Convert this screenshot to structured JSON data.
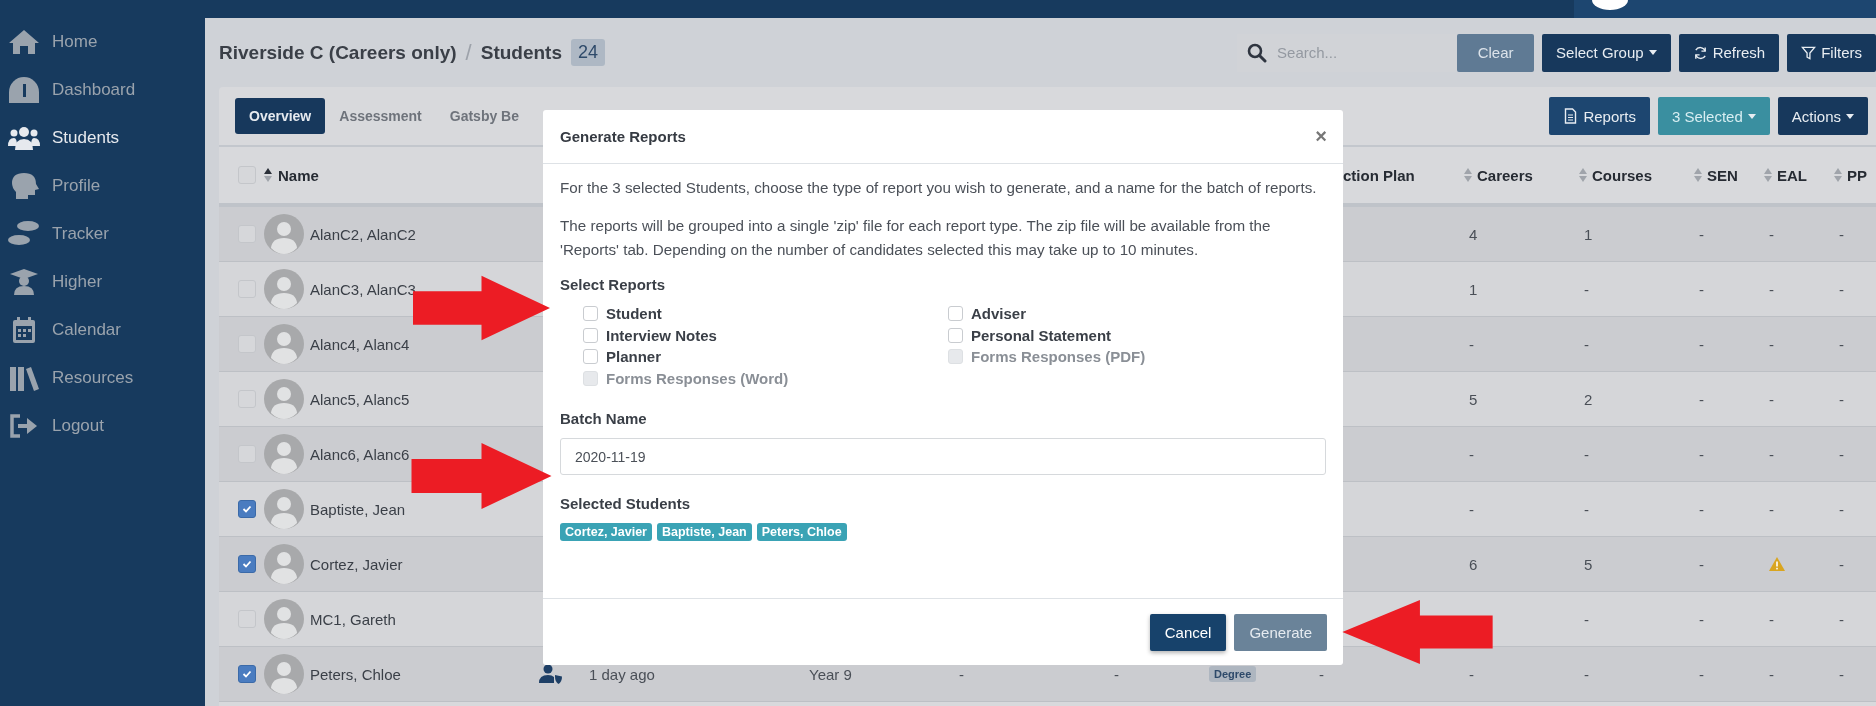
{
  "sidebar": {
    "items": [
      {
        "label": "Home",
        "selected": false
      },
      {
        "label": "Dashboard",
        "selected": false
      },
      {
        "label": "Students",
        "selected": true
      },
      {
        "label": "Profile",
        "selected": false
      },
      {
        "label": "Tracker",
        "selected": false
      },
      {
        "label": "Higher",
        "selected": false
      },
      {
        "label": "Calendar",
        "selected": false
      },
      {
        "label": "Resources",
        "selected": false
      },
      {
        "label": "Logout",
        "selected": false
      }
    ]
  },
  "header": {
    "breadcrumb": "Riverside C (Careers only)",
    "separator": "/",
    "page": "Students",
    "count": "24",
    "search": {
      "placeholder": "Search..."
    },
    "buttons": [
      {
        "label": "Clear",
        "kind": "light"
      },
      {
        "label": "Select Group",
        "kind": "dropdown"
      },
      {
        "label": "Refresh",
        "kind": "refresh"
      },
      {
        "label": "Filters",
        "kind": "filter"
      }
    ]
  },
  "card": {
    "tabs": [
      {
        "label": "Overview",
        "selected": true
      },
      {
        "label": "Assessment",
        "selected": false
      },
      {
        "label": "Gatsby Be",
        "selected": false
      }
    ],
    "actions": [
      {
        "label": "Reports",
        "kind": "reports"
      },
      {
        "label": "3 Selected",
        "kind": "teal-dropdown"
      },
      {
        "label": "Actions",
        "kind": "dropdown"
      }
    ]
  },
  "table": {
    "select_all": {
      "checked": false
    },
    "name_header": "Name",
    "columns": [
      "ction Plan",
      "Careers",
      "Courses",
      "SEN",
      "EAL",
      "PP"
    ],
    "rows": [
      {
        "name": "AlanC2, AlanC2",
        "checked": false,
        "cells": [
          {
            "kind": "text",
            "text": "4"
          },
          {
            "kind": "text",
            "text": "1"
          },
          {
            "kind": "text",
            "text": "-"
          },
          {
            "kind": "text",
            "text": "-"
          },
          {
            "kind": "text",
            "text": "-"
          }
        ]
      },
      {
        "name": "AlanC3, AlanC3",
        "checked": false,
        "cells": [
          {
            "kind": "text",
            "text": "1"
          },
          {
            "kind": "text",
            "text": "-"
          },
          {
            "kind": "text",
            "text": "-"
          },
          {
            "kind": "text",
            "text": "-"
          },
          {
            "kind": "text",
            "text": "-"
          }
        ]
      },
      {
        "name": "Alanc4, Alanc4",
        "checked": false,
        "cells": [
          {
            "kind": "text",
            "text": "-"
          },
          {
            "kind": "text",
            "text": "-"
          },
          {
            "kind": "text",
            "text": "-"
          },
          {
            "kind": "text",
            "text": "-"
          },
          {
            "kind": "text",
            "text": "-"
          }
        ]
      },
      {
        "name": "Alanc5, Alanc5",
        "checked": false,
        "cells": [
          {
            "kind": "text",
            "text": "5"
          },
          {
            "kind": "text",
            "text": "2"
          },
          {
            "kind": "text",
            "text": "-"
          },
          {
            "kind": "text",
            "text": "-"
          },
          {
            "kind": "text",
            "text": "-"
          }
        ]
      },
      {
        "name": "Alanc6, Alanc6",
        "checked": false,
        "cells": [
          {
            "kind": "text",
            "text": "-"
          },
          {
            "kind": "text",
            "text": "-"
          },
          {
            "kind": "text",
            "text": "-"
          },
          {
            "kind": "text",
            "text": "-"
          },
          {
            "kind": "text",
            "text": "-"
          }
        ]
      },
      {
        "name": "Baptiste, Jean",
        "checked": true,
        "cells": [
          {
            "kind": "text",
            "text": "-"
          },
          {
            "kind": "text",
            "text": "-"
          },
          {
            "kind": "text",
            "text": "-"
          },
          {
            "kind": "text",
            "text": "-"
          },
          {
            "kind": "text",
            "text": "-"
          }
        ]
      },
      {
        "name": "Cortez, Javier",
        "checked": true,
        "cells": [
          {
            "kind": "text",
            "text": "6"
          },
          {
            "kind": "text",
            "text": "5"
          },
          {
            "kind": "text",
            "text": "-"
          },
          {
            "kind": "warning"
          },
          {
            "kind": "text",
            "text": "-"
          }
        ]
      },
      {
        "name": "MC1, Gareth",
        "checked": false,
        "cells": [
          {
            "kind": "blank"
          },
          {
            "kind": "text",
            "text": "-"
          },
          {
            "kind": "text",
            "text": "-"
          },
          {
            "kind": "text",
            "text": "-"
          },
          {
            "kind": "text",
            "text": "-"
          }
        ]
      },
      {
        "name": "Peters, Chloe",
        "checked": true,
        "middle": [
          {
            "kind": "icon"
          },
          {
            "kind": "text",
            "text": "1 day ago"
          },
          {
            "kind": "text",
            "text": "Year 9"
          },
          {
            "kind": "text",
            "text": "-"
          },
          {
            "kind": "text",
            "text": "-"
          },
          {
            "kind": "badge",
            "text": "Degree"
          },
          {
            "kind": "text",
            "text": "-"
          }
        ],
        "cells": [
          {
            "kind": "text",
            "text": "-"
          },
          {
            "kind": "text",
            "text": "-"
          },
          {
            "kind": "text",
            "text": "-"
          },
          {
            "kind": "text",
            "text": "-"
          },
          {
            "kind": "text",
            "text": "-"
          }
        ]
      }
    ]
  },
  "modal": {
    "title": "Generate Reports",
    "close": "×",
    "paragraphs": [
      "For the 3 selected Students, choose the type of report you wish to generate, and a name for the batch of reports.",
      "The reports will be grouped into a single 'zip' file for each report type. The zip file will be available from the 'Reports' tab. Depending on the number of candidates selected this may take up to 10 minutes."
    ],
    "select_label": "Select Reports",
    "options": [
      {
        "label": "Student",
        "checked": false,
        "disabled": false
      },
      {
        "label": "Adviser",
        "checked": false,
        "disabled": false
      },
      {
        "label": "Interview Notes",
        "checked": false,
        "disabled": false
      },
      {
        "label": "Personal Statement",
        "checked": false,
        "disabled": false
      },
      {
        "label": "Planner",
        "checked": false,
        "disabled": false
      },
      {
        "label": "Forms Responses (PDF)",
        "checked": false,
        "disabled": true
      },
      {
        "label": "Forms Responses (Word)",
        "checked": false,
        "disabled": true
      }
    ],
    "batch_label": "Batch Name",
    "batch_value": "2020-11-19",
    "students_label": "Selected Students",
    "students": [
      "Cortez, Javier",
      "Baptiste, Jean",
      "Peters, Chloe"
    ],
    "buttons": [
      {
        "label": "Cancel",
        "kind": "primary",
        "disabled": false
      },
      {
        "label": "Generate",
        "kind": "primary",
        "disabled": true
      }
    ]
  }
}
